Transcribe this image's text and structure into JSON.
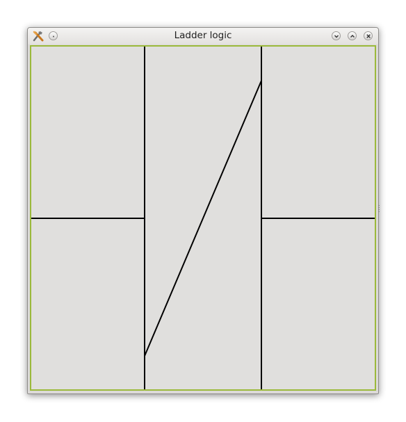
{
  "window": {
    "title": "Ladder logic",
    "icons": {
      "app": "kde-tools-icon",
      "menu": "window-menu-icon",
      "minimize": "chevron-down-icon",
      "maximize": "chevron-up-icon",
      "close": "close-icon"
    }
  },
  "colors": {
    "frame_accent": "#9bb93a",
    "canvas_background": "#e0dfdd",
    "line": "#000000"
  }
}
